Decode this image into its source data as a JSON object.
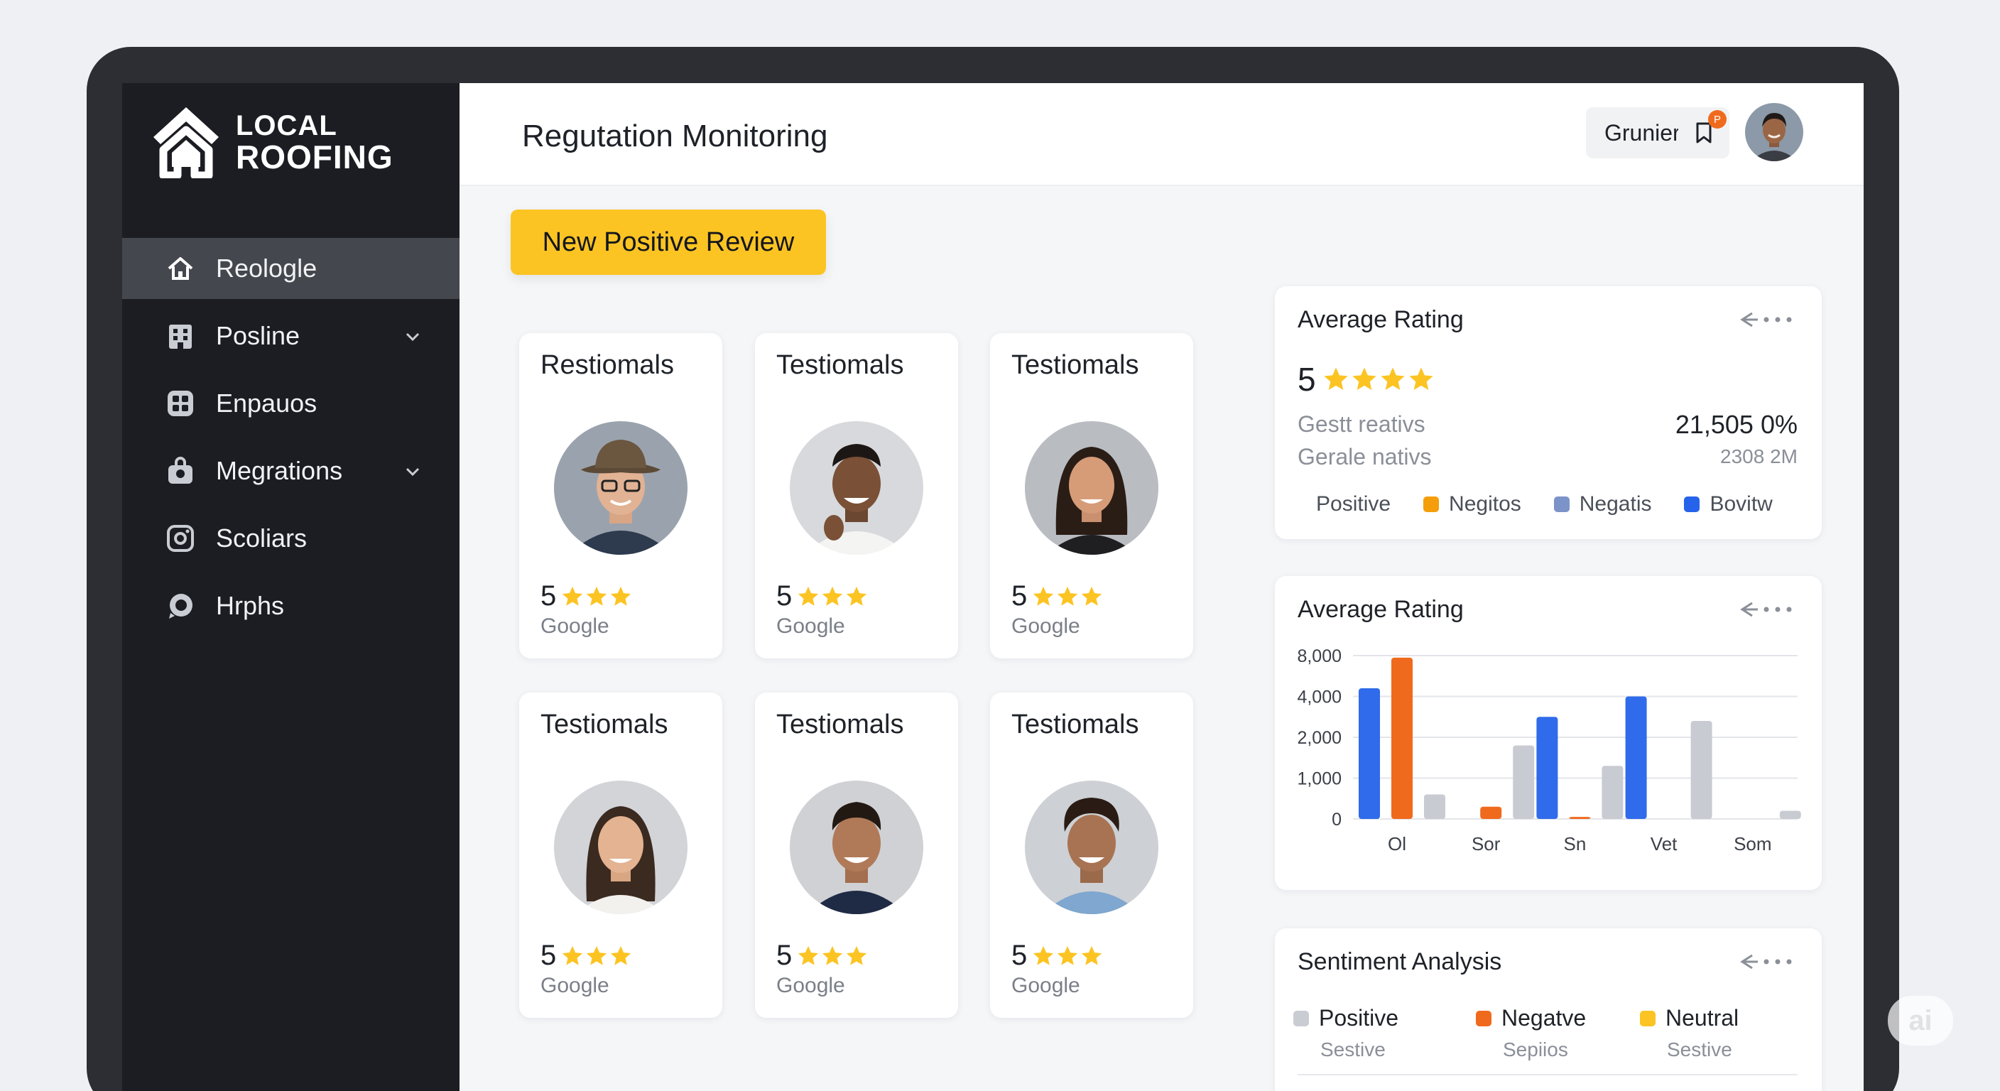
{
  "brand": {
    "line1": "LOCAL",
    "line2": "ROOFING"
  },
  "sidebar": {
    "items": [
      {
        "label": "Reologle",
        "icon": "home-icon",
        "active": true,
        "chevron": false
      },
      {
        "label": "Posline",
        "icon": "building-icon",
        "active": false,
        "chevron": true
      },
      {
        "label": "Enpauos",
        "icon": "grid-icon",
        "active": false,
        "chevron": false
      },
      {
        "label": "Megrations",
        "icon": "bag-icon",
        "active": false,
        "chevron": true
      },
      {
        "label": "Scoliars",
        "icon": "camera-icon",
        "active": false,
        "chevron": false
      },
      {
        "label": "Hrphs",
        "icon": "chat-bubble-icon",
        "active": false,
        "chevron": false
      }
    ]
  },
  "header": {
    "title": "Regutation Monitoring",
    "user_label": "Grunier",
    "notification_count": "P"
  },
  "cta_label": "New Positive Review",
  "testimonials": [
    {
      "title": "Restiomals",
      "score": "5",
      "stars": 3,
      "source": "Google"
    },
    {
      "title": "Testiomals",
      "score": "5",
      "stars": 3,
      "source": "Google"
    },
    {
      "title": "Testiomals",
      "score": "5",
      "stars": 3,
      "source": "Google"
    },
    {
      "title": "Testiomals",
      "score": "5",
      "stars": 3,
      "source": "Google"
    },
    {
      "title": "Testiomals",
      "score": "5",
      "stars": 3,
      "source": "Google"
    },
    {
      "title": "Testiomals",
      "score": "5",
      "stars": 3,
      "source": "Google"
    }
  ],
  "rating_panel": {
    "title": "Average Rating",
    "score": "5",
    "stars": 4,
    "row1_label": "Gestt reativs",
    "row1_value": "21,505 0%",
    "row2_label": "Gerale nativs",
    "row2_value": "2308 2M",
    "legend": [
      {
        "label": "Positive",
        "color": ""
      },
      {
        "label": "Negitos",
        "color": "#f59e0b"
      },
      {
        "label": "Negatis",
        "color": "#7b93c8"
      },
      {
        "label": "Bovitw",
        "color": "#2563eb"
      }
    ]
  },
  "chart_panel": {
    "title": "Average Rating"
  },
  "chart_data": {
    "type": "bar",
    "title": "Average Rating",
    "xlabel": "",
    "ylabel": "",
    "y_ticks": [
      "8,000",
      "4,000",
      "2,000",
      "1,000",
      "0"
    ],
    "categories": [
      "Ol",
      "Sor",
      "Sn",
      "Vet",
      "Som"
    ],
    "grid": true,
    "series": [
      {
        "color": "#2f6bea",
        "values": [
          4800,
          0,
          3000,
          4000,
          0
        ]
      },
      {
        "color": "#f06a1d",
        "values": [
          7800,
          300,
          50,
          0,
          0
        ]
      },
      {
        "color": "#c8cbd2",
        "values": [
          600,
          1800,
          1300,
          2800,
          200
        ]
      }
    ]
  },
  "sentiment": {
    "title": "Sentiment Analysis",
    "items": [
      {
        "label": "Positive",
        "sub": "Sestive",
        "color": "#c9ccd3"
      },
      {
        "label": "Negatve",
        "sub": "Sepiios",
        "color": "#f06a1d"
      },
      {
        "label": "Neutral",
        "sub": "Sestive",
        "color": "#fcc423"
      }
    ]
  },
  "watermark": "ai"
}
